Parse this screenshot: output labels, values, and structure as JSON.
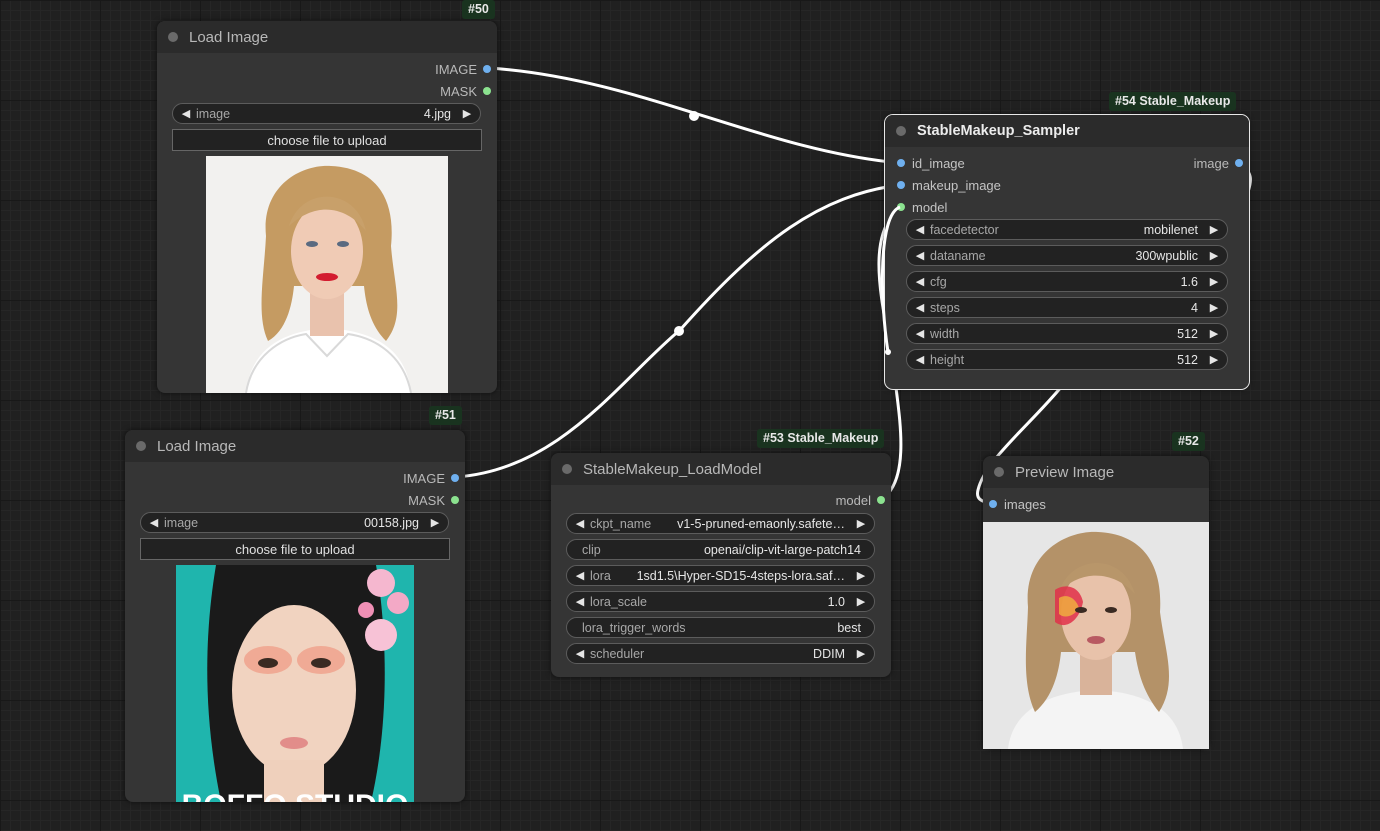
{
  "nodes": {
    "load_image_50": {
      "badge": "#50",
      "title": "Load Image",
      "outputs": {
        "image": "IMAGE",
        "mask": "MASK"
      },
      "image_widget": {
        "label": "image",
        "value": "4.jpg"
      },
      "upload_button": "choose file to upload"
    },
    "load_image_51": {
      "badge": "#51",
      "title": "Load Image",
      "outputs": {
        "image": "IMAGE",
        "mask": "MASK"
      },
      "image_widget": {
        "label": "image",
        "value": "00158.jpg"
      },
      "upload_button": "choose file to upload",
      "preview_text": "BOFFO STUDIO"
    },
    "load_model_53": {
      "badge": "#53 Stable_Makeup",
      "title": "StableMakeup_LoadModel",
      "outputs": {
        "model": "model"
      },
      "widgets": [
        {
          "label": "ckpt_name",
          "value": "v1-5-pruned-emaonly.safete…"
        },
        {
          "label": "clip",
          "value": "openai/clip-vit-large-patch14"
        },
        {
          "label": "lora",
          "value": "1sd1.5\\Hyper-SD15-4steps-lora.saf…"
        },
        {
          "label": "lora_scale",
          "value": "1.0"
        },
        {
          "label": "lora_trigger_words",
          "value": "best"
        },
        {
          "label": "scheduler",
          "value": "DDIM"
        }
      ]
    },
    "sampler_54": {
      "badge": "#54 Stable_Makeup",
      "title": "StableMakeup_Sampler",
      "inputs": {
        "id_image": "id_image",
        "makeup_image": "makeup_image",
        "model": "model"
      },
      "outputs": {
        "image": "image"
      },
      "widgets": [
        {
          "label": "facedetector",
          "value": "mobilenet"
        },
        {
          "label": "dataname",
          "value": "300wpublic"
        },
        {
          "label": "cfg",
          "value": "1.6"
        },
        {
          "label": "steps",
          "value": "4"
        },
        {
          "label": "width",
          "value": "512"
        },
        {
          "label": "height",
          "value": "512"
        }
      ]
    },
    "preview_52": {
      "badge": "#52",
      "title": "Preview Image",
      "inputs": {
        "images": "images"
      }
    }
  },
  "arrows": {
    "left": "◀",
    "right": "▶"
  },
  "colors": {
    "canvas": "#202020",
    "node_body": "#353535",
    "node_title": "#2b2b2b",
    "badge": "#19331f",
    "image_port": "#6fb0ef",
    "mask_model_port": "#8be28f",
    "link": "#ffffff"
  }
}
